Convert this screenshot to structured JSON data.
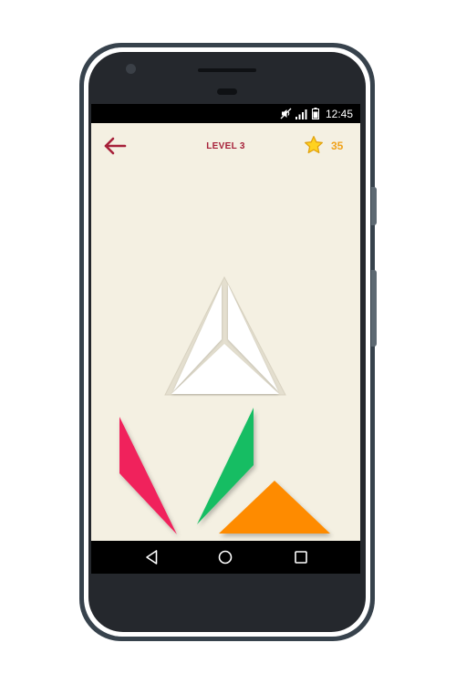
{
  "status_bar": {
    "time": "12:45",
    "icons": [
      "mute-icon",
      "signal-icon",
      "battery-icon"
    ]
  },
  "header": {
    "back_icon": "arrow-left-icon",
    "level_label": "LEVEL 3",
    "star_icon": "star-icon",
    "star_count": "35"
  },
  "nav_bar": {
    "buttons": [
      "back-triangle-icon",
      "home-circle-icon",
      "recents-square-icon"
    ]
  },
  "puzzle": {
    "target_shape": "triangle",
    "pieces": [
      {
        "name": "red-piece",
        "color": "#f0215b"
      },
      {
        "name": "green-piece",
        "color": "#17bd64"
      },
      {
        "name": "orange-piece",
        "color": "#fe8b05"
      }
    ]
  },
  "colors": {
    "background": "#f4f0e2",
    "accent": "#a62039",
    "star": "#f0a21a"
  }
}
